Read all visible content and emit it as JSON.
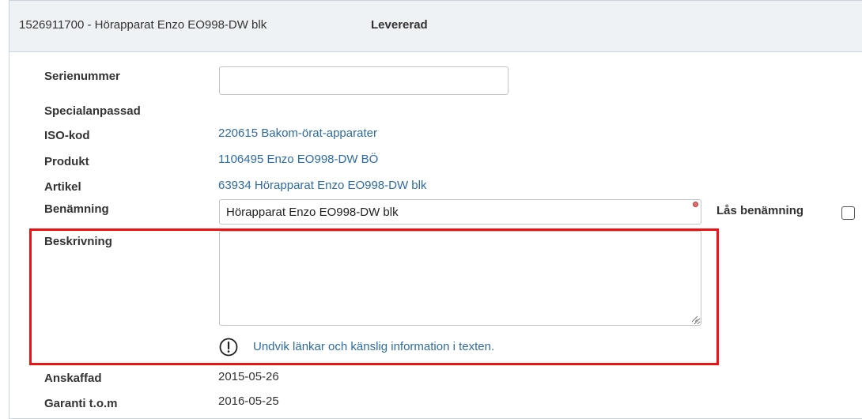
{
  "header": {
    "title": "1526911700 - Hörapparat Enzo EO998-DW blk",
    "status": "Levererad"
  },
  "fields": {
    "serienummer": {
      "label": "Serienummer",
      "value": "",
      "placeholder": ""
    },
    "specialanpassad": {
      "label": "Specialanpassad"
    },
    "iso_kod": {
      "label": "ISO-kod",
      "value": "220615 Bakom-örat-apparater"
    },
    "produkt": {
      "label": "Produkt",
      "value": "1106495 Enzo EO998-DW BÖ"
    },
    "artikel": {
      "label": "Artikel",
      "value": "63934 Hörapparat Enzo EO998-DW blk"
    },
    "benamning": {
      "label": "Benämning",
      "value": "Hörapparat Enzo EO998-DW blk",
      "lock_label": "Lås benämning",
      "lock_checked": false
    },
    "beskrivning": {
      "label": "Beskrivning",
      "value": "",
      "warning": "Undvik länkar och känslig information i texten."
    },
    "anskaffad": {
      "label": "Anskaffad",
      "value": "2015-05-26"
    },
    "garanti": {
      "label": "Garanti t.o.m",
      "value": "2016-05-25"
    }
  },
  "icons": {
    "warning": "exclamation-circle-icon",
    "required": "required-dot-icon",
    "resize": "resize-grip-icon"
  },
  "colors": {
    "link": "#2d6ca2",
    "highlight": "#ee1111",
    "header_bg": "#eef2f5"
  }
}
